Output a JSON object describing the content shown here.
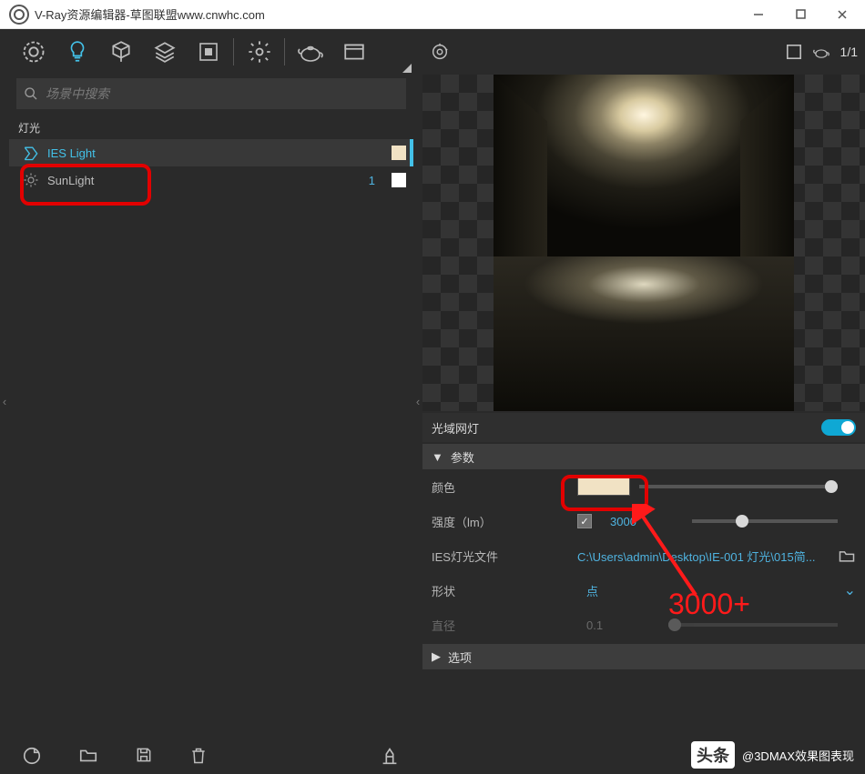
{
  "window": {
    "title": "V-Ray资源编辑器-草图联盟www.cnwhc.com"
  },
  "search": {
    "placeholder": "场景中搜索"
  },
  "section": {
    "lights": "灯光"
  },
  "list": {
    "items": [
      {
        "name": "IES Light",
        "swatch": "#f1e2c4",
        "selected": true
      },
      {
        "name": "SunLight",
        "count": "1",
        "swatch": "#ffffff",
        "selected": false
      }
    ]
  },
  "previewHdr": {
    "ratio": "1/1"
  },
  "panel": {
    "title": "光域网灯"
  },
  "accordion": {
    "params": "参数",
    "options": "选项"
  },
  "params": {
    "color": {
      "label": "颜色",
      "swatch": "#f1e2c4"
    },
    "intensity": {
      "label": "强度（lm）",
      "value": "3000"
    },
    "iesfile": {
      "label": "IES灯光文件",
      "value": "C:\\Users\\admin\\Desktop\\IE-001 灯光\\015简..."
    },
    "shape": {
      "label": "形状",
      "value": "点"
    },
    "diameter": {
      "label": "直径",
      "value": "0.1"
    }
  },
  "annotation": {
    "text": "3000+"
  },
  "watermark": {
    "badge": "头条",
    "text": "@3DMAX效果图表现"
  }
}
